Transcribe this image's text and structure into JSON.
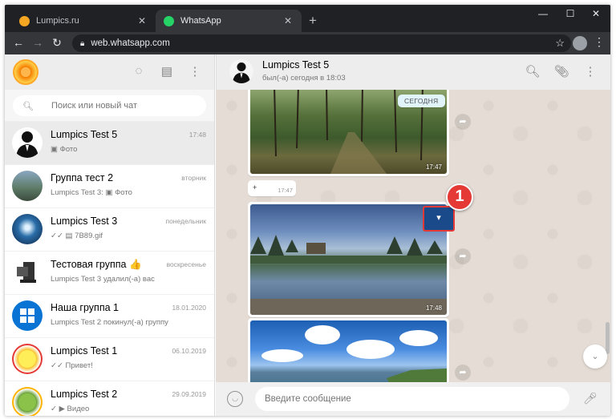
{
  "browser": {
    "tabs": [
      {
        "title": "Lumpics.ru",
        "favicon_color": "#f5a623"
      },
      {
        "title": "WhatsApp",
        "favicon_color": "#25d366"
      }
    ],
    "url": "web.whatsapp.com",
    "new_tab": "+",
    "window_controls": {
      "minimize": "—",
      "maximize": "☐",
      "close": "✕"
    }
  },
  "sidebar": {
    "search_placeholder": "Поиск или новый чат",
    "chats": [
      {
        "name": "Lumpics Test 5",
        "time": "17:48",
        "preview": "▣ Фото"
      },
      {
        "name": "Группа тест 2",
        "time": "вторник",
        "preview": "Lumpics Test 3: ▣ Фото"
      },
      {
        "name": "Lumpics Test 3",
        "time": "понедельник",
        "preview": "✓✓ ▤ 7B89.gif"
      },
      {
        "name": "Тестовая группа 👍",
        "time": "воскресенье",
        "preview": "Lumpics Test 3 удалил(-а) вас"
      },
      {
        "name": "Наша группа 1",
        "time": "18.01.2020",
        "preview": "Lumpics Test 2 покинул(-а) группу"
      },
      {
        "name": "Lumpics Test 1",
        "time": "06.10.2019",
        "preview": "✓✓ Привет!"
      },
      {
        "name": "Lumpics Test 2",
        "time": "29.09.2019",
        "preview": "✓ ▶ Видео"
      }
    ]
  },
  "conversation": {
    "contact_name": "Lumpics Test 5",
    "status": "был(-а) сегодня в 18:03",
    "date_label": "СЕГОДНЯ",
    "messages": [
      {
        "type": "photo",
        "time": "17:47"
      },
      {
        "type": "text",
        "text": "+",
        "time": "17:47"
      },
      {
        "type": "photo",
        "time": "17:48"
      },
      {
        "type": "photo",
        "time": ""
      }
    ],
    "annotation_number": "1",
    "compose_placeholder": "Введите сообщение"
  },
  "icons": [
    "status-icon",
    "new-chat-icon",
    "menu-icon",
    "search-icon",
    "attach-icon",
    "forward-icon",
    "chevron-down-icon",
    "emoji-icon",
    "mic-icon"
  ]
}
